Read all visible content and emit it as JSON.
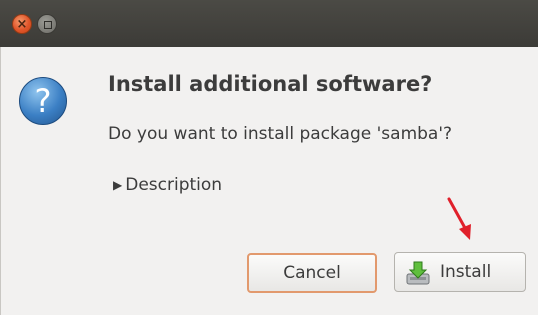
{
  "window": {
    "close_glyph": "×"
  },
  "dialog": {
    "icon_glyph": "?",
    "title": "Install additional software?",
    "message": "Do you want to install package 'samba'?",
    "expander_label": "Description",
    "expander_glyph": "▶",
    "buttons": {
      "cancel_label": "Cancel",
      "install_label": "Install"
    }
  },
  "annotation": {
    "arrow_color": "#e0202b"
  }
}
